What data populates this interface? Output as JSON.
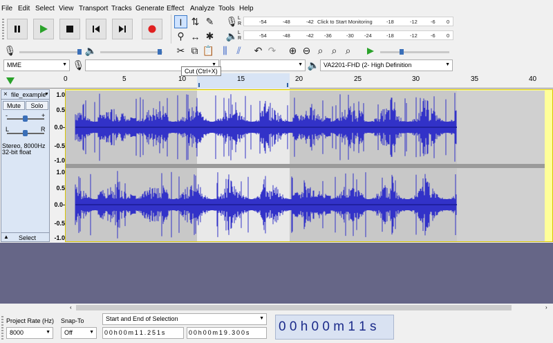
{
  "menu": [
    "File",
    "Edit",
    "Select",
    "View",
    "Transport",
    "Tracks",
    "Generate",
    "Effect",
    "Analyze",
    "Tools",
    "Help"
  ],
  "meter": {
    "record_scale": [
      "L",
      "R",
      "-54",
      "-48",
      "-42",
      "Click to Start Monitoring",
      "-18",
      "-12",
      "-6",
      "0"
    ],
    "play_scale": [
      "L",
      "R",
      "-54",
      "-48",
      "-42",
      "-36",
      "-30",
      "-24",
      "-18",
      "-12",
      "-6",
      "0"
    ]
  },
  "device": {
    "host": "MME",
    "recording_device": "",
    "channels": "",
    "playback_device": "VA2201-FHD (2- High Definition"
  },
  "tooltip": "Cut (Ctrl+X)",
  "ruler": {
    "ticks": [
      "0",
      "5",
      "10",
      "15",
      "20",
      "25",
      "30",
      "35",
      "40"
    ]
  },
  "track": {
    "name": "file_example",
    "mute": "Mute",
    "solo": "Solo",
    "gain_l": "-",
    "gain_r": "+",
    "pan_l": "L",
    "pan_r": "R",
    "info1": "Stereo, 8000Hz",
    "info2": "32-bit float",
    "select": "Select",
    "scale": [
      "1.0",
      "0.5",
      "0.0-",
      "-0.5",
      "-1.0"
    ]
  },
  "bottom": {
    "project_rate_label": "Project Rate (Hz)",
    "project_rate": "8000",
    "snap_label": "Snap-To",
    "snap": "Off",
    "selection_mode": "Start and End of Selection",
    "sel_start": "0 0 h 0 0 m 1 1 . 2 5 1 s",
    "sel_end": "0 0 h 0 0 m 1 9 . 3 0 0 s",
    "audio_position": "0 0 h 0 0 m 1 1 s"
  },
  "colors": {
    "wave": "#3232c8",
    "selection": "#ffffff",
    "track_bg": "#c8c8c8",
    "empty": "#666687"
  }
}
